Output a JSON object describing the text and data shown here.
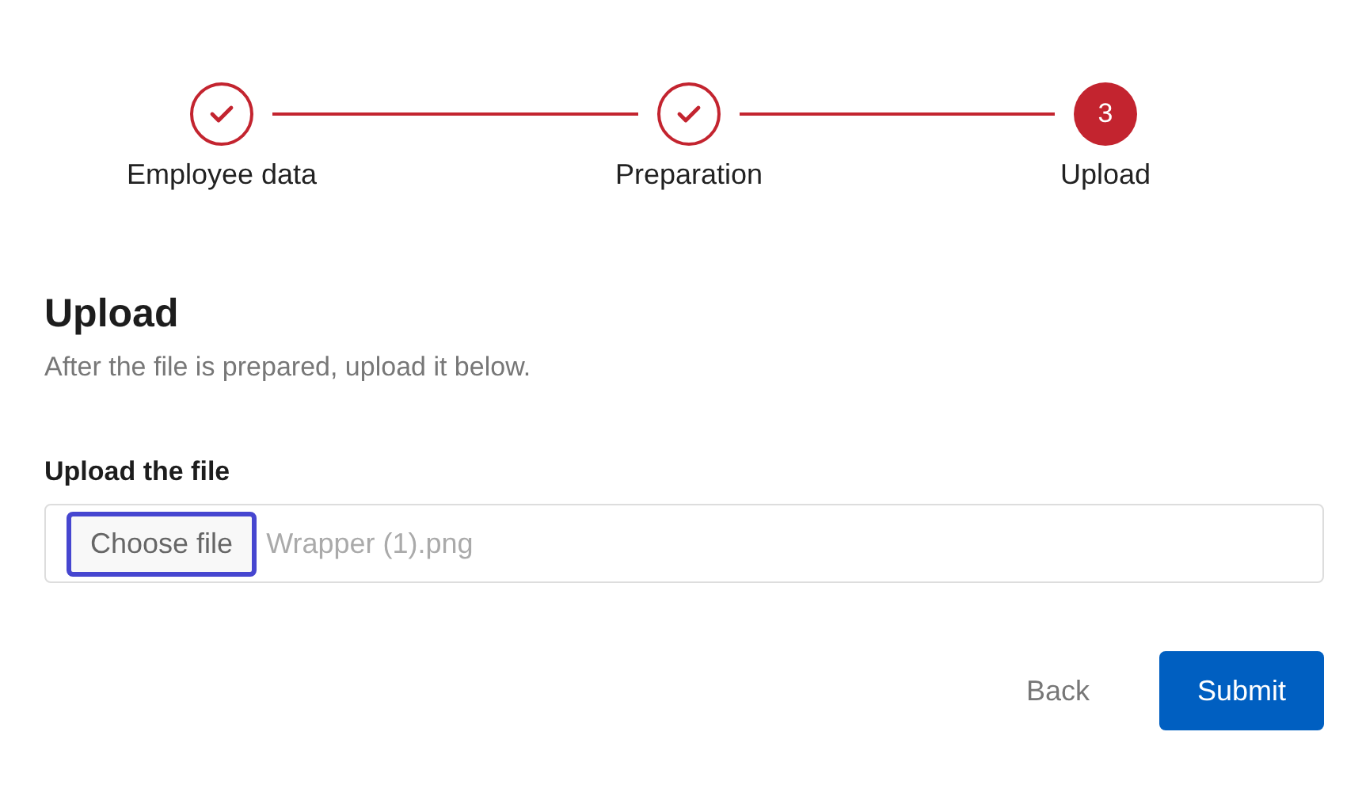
{
  "steps": [
    {
      "label": "Employee data",
      "completed": true,
      "selected": false
    },
    {
      "label": "Preparation",
      "completed": true,
      "selected": false
    },
    {
      "label": "Upload",
      "completed": false,
      "selected": true,
      "number": "3"
    }
  ],
  "heading": "Upload",
  "description": "After the file is prepared, upload it below.",
  "file_field": {
    "label": "Upload the file",
    "button": "Choose file",
    "focused": true,
    "value": "Wrapper (1).png"
  },
  "buttons": [
    {
      "label": "Back",
      "kind": "secondary"
    },
    {
      "label": "Submit",
      "kind": "primary"
    }
  ]
}
